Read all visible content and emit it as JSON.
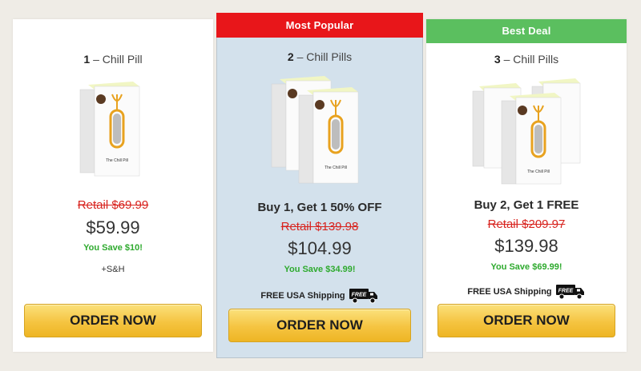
{
  "offers": [
    {
      "banner": "",
      "qty_number": "1",
      "qty_label": " – Chill Pill",
      "deal": "",
      "retail": "Retail $69.99",
      "price": "$59.99",
      "save": "You Save $10!",
      "shipping_note": "+S&H",
      "free_shipping": "",
      "button": "ORDER NOW"
    },
    {
      "banner": "Most Popular",
      "qty_number": "2",
      "qty_label": " – Chill Pills",
      "deal": "Buy 1, Get 1 50% OFF",
      "retail": "Retail $139.98",
      "price": "$104.99",
      "save": "You Save $34.99!",
      "shipping_note": "",
      "free_shipping": "FREE USA Shipping",
      "button": "ORDER NOW"
    },
    {
      "banner": "Best Deal",
      "qty_number": "3",
      "qty_label": " – Chill Pills",
      "deal": "Buy 2, Get 1 FREE",
      "retail": "Retail $209.97",
      "price": "$139.98",
      "save": "You Save $69.99!",
      "shipping_note": "",
      "free_shipping": "FREE USA Shipping",
      "button": "ORDER NOW"
    }
  ],
  "truck_badge": "FREE",
  "product_box_label": "The Chill Pill",
  "colors": {
    "most_popular_banner": "#e8161a",
    "best_deal_banner": "#5bbf5f",
    "retail_strike": "#d8231e",
    "savings": "#2eaa2e",
    "button": "#f5c441",
    "featured_card": "#d3e1ec"
  }
}
